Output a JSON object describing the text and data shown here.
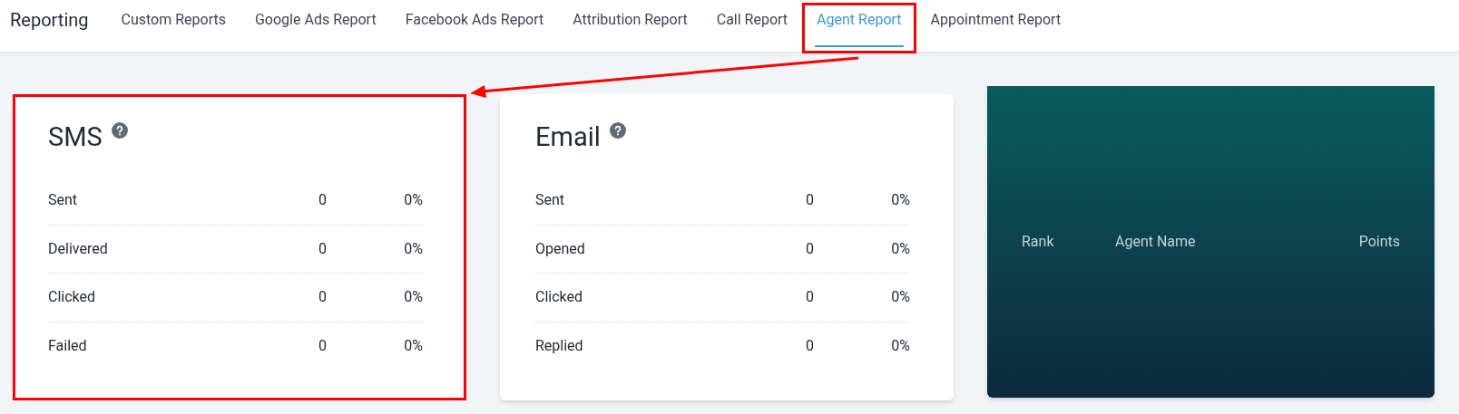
{
  "header": {
    "title": "Reporting"
  },
  "tabs": [
    {
      "label": "Custom Reports",
      "selected": false,
      "annotated": false
    },
    {
      "label": "Google Ads Report",
      "selected": false,
      "annotated": false
    },
    {
      "label": "Facebook Ads Report",
      "selected": false,
      "annotated": false
    },
    {
      "label": "Attribution Report",
      "selected": false,
      "annotated": false
    },
    {
      "label": "Call Report",
      "selected": false,
      "annotated": false
    },
    {
      "label": "Agent Report",
      "selected": true,
      "annotated": true
    },
    {
      "label": "Appointment Report",
      "selected": false,
      "annotated": false
    }
  ],
  "cards": [
    {
      "title": "SMS",
      "annotated": true,
      "rows": [
        {
          "label": "Sent",
          "count": "0",
          "percent": "0%"
        },
        {
          "label": "Delivered",
          "count": "0",
          "percent": "0%"
        },
        {
          "label": "Clicked",
          "count": "0",
          "percent": "0%"
        },
        {
          "label": "Failed",
          "count": "0",
          "percent": "0%"
        }
      ]
    },
    {
      "title": "Email",
      "annotated": false,
      "rows": [
        {
          "label": "Sent",
          "count": "0",
          "percent": "0%"
        },
        {
          "label": "Opened",
          "count": "0",
          "percent": "0%"
        },
        {
          "label": "Clicked",
          "count": "0",
          "percent": "0%"
        },
        {
          "label": "Replied",
          "count": "0",
          "percent": "0%"
        }
      ]
    }
  ],
  "leaderboard": {
    "columns": [
      "Rank",
      "Agent Name",
      "Points"
    ]
  }
}
